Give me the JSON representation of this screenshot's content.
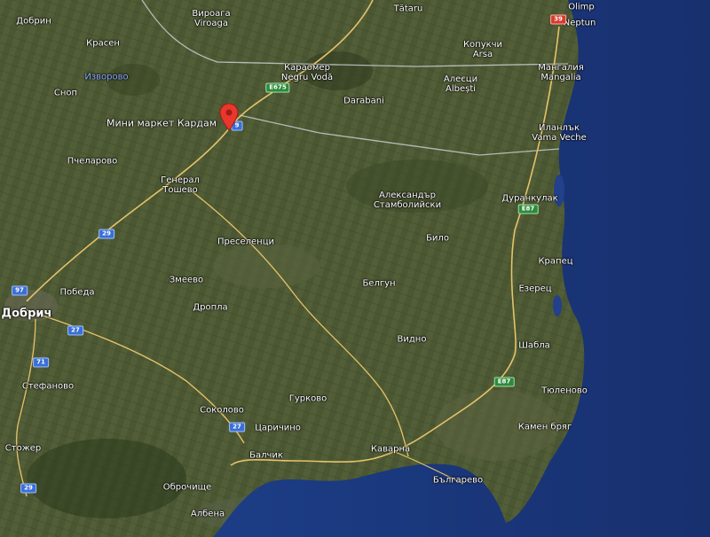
{
  "map": {
    "pin_place": "Мини маркет Кардам",
    "places": [
      {
        "id": "dobrin",
        "text": "Добрин"
      },
      {
        "id": "viroaga",
        "text": "Вироага\nViroaga"
      },
      {
        "id": "tataru",
        "text": "Tătaru"
      },
      {
        "id": "olimp",
        "text": "Olimp"
      },
      {
        "id": "neptun",
        "text": "Neptun"
      },
      {
        "id": "krasen",
        "text": "Красен"
      },
      {
        "id": "kopuchi",
        "text": "Копукчи\nArsa"
      },
      {
        "id": "karaomer",
        "text": "Караомер\nNegru Vodă"
      },
      {
        "id": "izvorovo",
        "text": "Изворово"
      },
      {
        "id": "mangalia",
        "text": "Мангалия\nMangalia"
      },
      {
        "id": "alecsi",
        "text": "Алеєци\nAlbești"
      },
      {
        "id": "snop",
        "text": "Сноп"
      },
      {
        "id": "darabani",
        "text": "Darabani"
      },
      {
        "id": "ilanluk",
        "text": "Иланлък\nVama Veche"
      },
      {
        "id": "pchelarovo",
        "text": "Пчеларово"
      },
      {
        "id": "general",
        "text": "Генерал\nТошево"
      },
      {
        "id": "aleksandr",
        "text": "Александър\nСтамболийски"
      },
      {
        "id": "durankulak",
        "text": "Дуранкулак"
      },
      {
        "id": "preselentsi",
        "text": "Преселенци"
      },
      {
        "id": "bilo",
        "text": "Било"
      },
      {
        "id": "krapets",
        "text": "Крапец"
      },
      {
        "id": "pobeda",
        "text": "Победа"
      },
      {
        "id": "zmeevo",
        "text": "Змеево"
      },
      {
        "id": "belgun",
        "text": "Белгун"
      },
      {
        "id": "ezerets",
        "text": "Езерец"
      },
      {
        "id": "dobrich",
        "text": "Добрич"
      },
      {
        "id": "dropla",
        "text": "Дропла"
      },
      {
        "id": "vidno",
        "text": "Видно"
      },
      {
        "id": "shabla",
        "text": "Шабла"
      },
      {
        "id": "stefanovo",
        "text": "Стефаново"
      },
      {
        "id": "tyulenovo",
        "text": "Тюленово"
      },
      {
        "id": "gurkovo",
        "text": "Гурково"
      },
      {
        "id": "sokolovo",
        "text": "Соколово"
      },
      {
        "id": "kamen",
        "text": "Камен бряг"
      },
      {
        "id": "tsarichino",
        "text": "Царичино"
      },
      {
        "id": "stozher",
        "text": "Стожер"
      },
      {
        "id": "balchik",
        "text": "Балчик"
      },
      {
        "id": "kavarna",
        "text": "Каварна"
      },
      {
        "id": "bulgarevo",
        "text": "Българево"
      },
      {
        "id": "obrochishte",
        "text": "Оброчище"
      },
      {
        "id": "albena",
        "text": "Албена"
      }
    ],
    "roads": [
      {
        "id": "r_e675",
        "text": "E675",
        "color": "green"
      },
      {
        "id": "r_39",
        "text": "39",
        "color": "red"
      },
      {
        "id": "r_29a",
        "text": "29",
        "color": "blue"
      },
      {
        "id": "r_97",
        "text": "97",
        "color": "blue"
      },
      {
        "id": "r_27a",
        "text": "27",
        "color": "blue"
      },
      {
        "id": "r_71",
        "text": "71",
        "color": "blue"
      },
      {
        "id": "r_27b",
        "text": "27",
        "color": "blue"
      },
      {
        "id": "r_29b",
        "text": "29",
        "color": "blue"
      },
      {
        "id": "r_e87a",
        "text": "E87",
        "color": "green"
      },
      {
        "id": "r_e87b",
        "text": "E87",
        "color": "green"
      },
      {
        "id": "r_9",
        "text": "9",
        "color": "blue"
      }
    ]
  }
}
